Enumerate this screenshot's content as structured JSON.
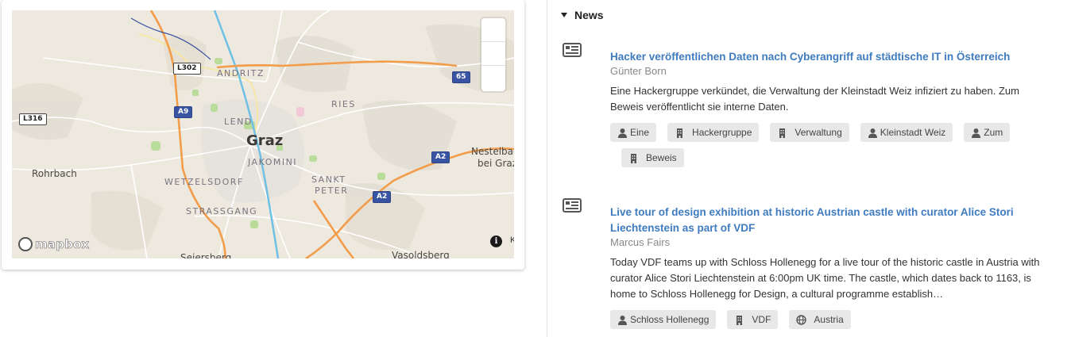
{
  "map": {
    "labels": {
      "graz": "Graz",
      "andritz": "ANDRITZ",
      "ries": "RIES",
      "lend": "LEND",
      "jakomini": "JAKOMINI",
      "wetzelsdorf": "WETZELSDORF",
      "sankt": "SANKT",
      "peter": "PETER",
      "strassgang": "STRASSGANG",
      "rohrbach": "Rohrbach",
      "nestelbach_1": "Nestelbach",
      "nestelbach_2": "bei Graz",
      "seiersberg": "Seiersberg",
      "vasoldsberg": "Vasoldsberg"
    },
    "shields": {
      "l302": "L302",
      "l316": "L316",
      "a9": "A9",
      "a65": "65",
      "a2_east": "A2",
      "a2_south": "A2"
    },
    "logo_text": "mapbox",
    "info_symbol": "i",
    "attribution_cut": "K"
  },
  "news": {
    "section_title": "News",
    "items": [
      {
        "icon": "newspaper-icon",
        "title": "Hacker veröffentlichen Daten nach Cyberangriff auf städtische IT in Österreich",
        "author": "Günter Born",
        "summary": "Eine Hackergruppe verkündet, die Verwaltung der Kleinstadt Weiz infiziert zu haben. Zum Beweis veröffentlicht sie interne Daten.",
        "tags": [
          {
            "type": "person",
            "icon": "person-icon",
            "label": "Eine"
          },
          {
            "type": "org",
            "icon": "building-icon",
            "label": "Hackergruppe"
          },
          {
            "type": "org",
            "icon": "building-icon",
            "label": "Verwaltung"
          },
          {
            "type": "person",
            "icon": "person-icon",
            "label": "Kleinstadt Weiz"
          },
          {
            "type": "person",
            "icon": "person-icon",
            "label": "Zum"
          },
          {
            "type": "org",
            "icon": "building-icon",
            "label": "Beweis"
          }
        ]
      },
      {
        "icon": "newspaper-icon",
        "title": "Live tour of design exhibition at historic Austrian castle with curator Alice Stori Liechtenstein as part of VDF",
        "author": "Marcus Fairs",
        "summary": "Today VDF teams up with Schloss Hollenegg for a live tour of the historic castle in Austria with curator Alice Stori Liechtenstein at 6:00pm UK time. The castle, which dates back to 1163, is home to Schloss Hollenegg for Design, a cultural programme establish…",
        "tags": [
          {
            "type": "person",
            "icon": "person-icon",
            "label": "Schloss Hollenegg"
          },
          {
            "type": "org",
            "icon": "building-icon",
            "label": "VDF"
          },
          {
            "type": "place",
            "icon": "globe-icon",
            "label": "Austria"
          }
        ]
      }
    ]
  },
  "colors": {
    "link": "#3f7bbf",
    "tag_bg": "#e8e8e8",
    "map_bg": "#ede9df",
    "motorway": "#f39c4a",
    "river": "#6ec1e4",
    "park": "#b9dc9b"
  }
}
